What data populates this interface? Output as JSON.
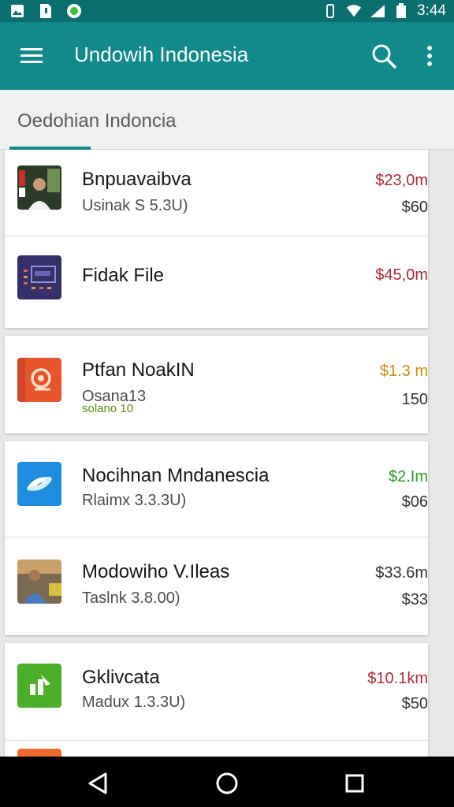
{
  "status_bar": {
    "time": "3:44"
  },
  "app_bar": {
    "title": "Undowih Indonesia"
  },
  "tabs": [
    {
      "label": "Oedohian Indoncia"
    }
  ],
  "cards": [
    {
      "items": [
        {
          "name": "Bnpuavaibva",
          "subtitle": "Usinak S 5.3U)",
          "price": "$23,0m",
          "amount": "$60",
          "price_color": "#b0283a"
        },
        {
          "name": "Fidak File",
          "price": "$45,0m",
          "price_color": "#b0283a"
        }
      ]
    },
    {
      "items": [
        {
          "name": "Ptfan NoakIN",
          "subtitle": "Osana13",
          "note": "solano 10",
          "price": "$1.3 m",
          "amount": "150",
          "price_color": "#d18a0a"
        }
      ]
    },
    {
      "items": [
        {
          "name": "Nocihnan Mndanescia",
          "subtitle": "Rlaimx 3.3.3U)",
          "price": "$2.Im",
          "amount": "$06",
          "price_color": "#2e9c2a"
        },
        {
          "name": "Modowiho V.Ileas",
          "subtitle": "Taslnk 3.8.00)",
          "price": "$33.6m",
          "amount": "$33",
          "price_color": "#333333"
        }
      ]
    },
    {
      "items": [
        {
          "name": "Gklivcata",
          "subtitle": "Madux 1.3.3U)",
          "price": "$10.1km",
          "amount": "$50",
          "price_color": "#b0283a"
        }
      ]
    }
  ],
  "icons": {
    "menu": "hamburger-icon",
    "search": "search-icon",
    "more": "more-vert-icon",
    "back": "back-icon",
    "home": "home-icon",
    "recents": "recents-icon"
  },
  "colors": {
    "primary": "#12898a",
    "status_bar": "#0b6f6f"
  }
}
